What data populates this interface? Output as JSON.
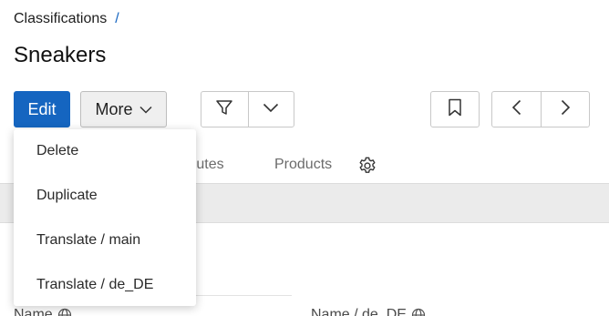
{
  "breadcrumb": {
    "root": "Classifications",
    "separator": "/"
  },
  "page": {
    "title": "Sneakers"
  },
  "actions": {
    "edit_label": "Edit",
    "more_label": "More"
  },
  "more_menu": {
    "items": [
      {
        "label": "Delete"
      },
      {
        "label": "Duplicate"
      },
      {
        "label": "Translate / main"
      },
      {
        "label": "Translate / de_DE"
      }
    ]
  },
  "tabs": {
    "attributes_label": "Attributes",
    "products_label": "Products",
    "settings_icon": "gear-icon"
  },
  "fields": {
    "name_label": "Name",
    "name_de_label": "Name / de_DE"
  },
  "icons": {
    "filter": "filter-icon",
    "dropdown": "chevron-down-icon",
    "bookmark": "bookmark-icon",
    "prev": "chevron-left-icon",
    "next": "chevron-right-icon",
    "translatable": "globe-icon"
  },
  "colors": {
    "primary": "#1565c0",
    "menu_bg": "#ffffff",
    "strip_bg": "#ebebeb"
  }
}
